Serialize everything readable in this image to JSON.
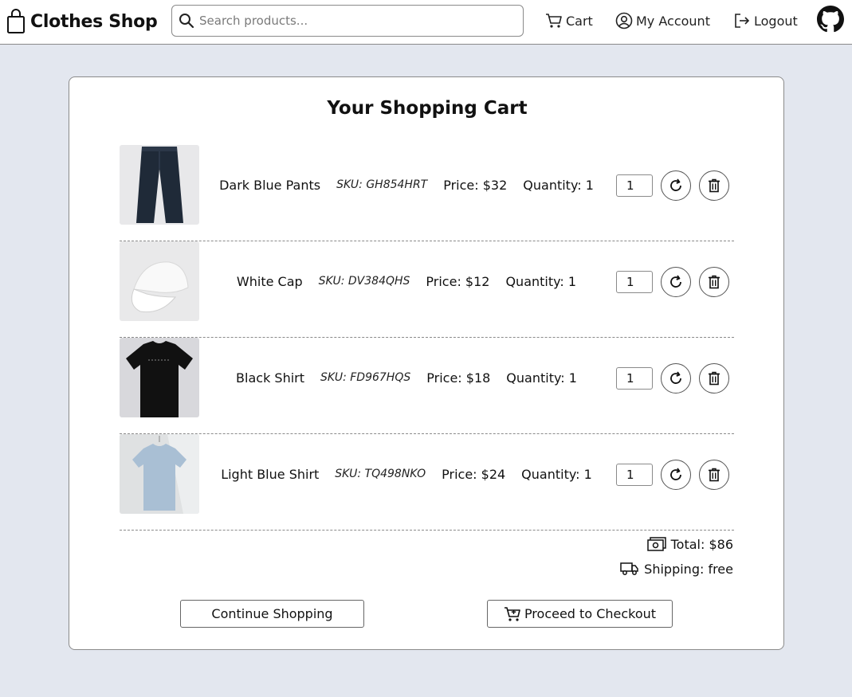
{
  "header": {
    "brand": "Clothes Shop",
    "search_placeholder": "Search products...",
    "nav": [
      {
        "label": "Cart",
        "icon": "cart-icon"
      },
      {
        "label": "My Account",
        "icon": "user-circle-icon"
      },
      {
        "label": "Logout",
        "icon": "logout-icon"
      }
    ],
    "github_icon": "github-icon"
  },
  "cart": {
    "title": "Your Shopping Cart",
    "items": [
      {
        "name": "Dark Blue Pants",
        "sku": "SKU: GH854HRT",
        "price": "Price: $32",
        "quantity": "Quantity: 1",
        "qty_value": "1"
      },
      {
        "name": "White Cap",
        "sku": "SKU: DV384QHS",
        "price": "Price: $12",
        "quantity": "Quantity: 1",
        "qty_value": "1"
      },
      {
        "name": "Black Shirt",
        "sku": "SKU: FD967HQS",
        "price": "Price: $18",
        "quantity": "Quantity: 1",
        "qty_value": "1"
      },
      {
        "name": "Light Blue Shirt",
        "sku": "SKU: TQ498NKO",
        "price": "Price: $24",
        "quantity": "Quantity: 1",
        "qty_value": "1"
      }
    ],
    "total": "Total: $86",
    "shipping": "Shipping: free",
    "continue_label": "Continue Shopping",
    "checkout_label": "Proceed to Checkout"
  },
  "colors": {
    "page_bg": "#e3e7ef",
    "card_bg": "#ffffff",
    "border": "#8a8a8a"
  }
}
